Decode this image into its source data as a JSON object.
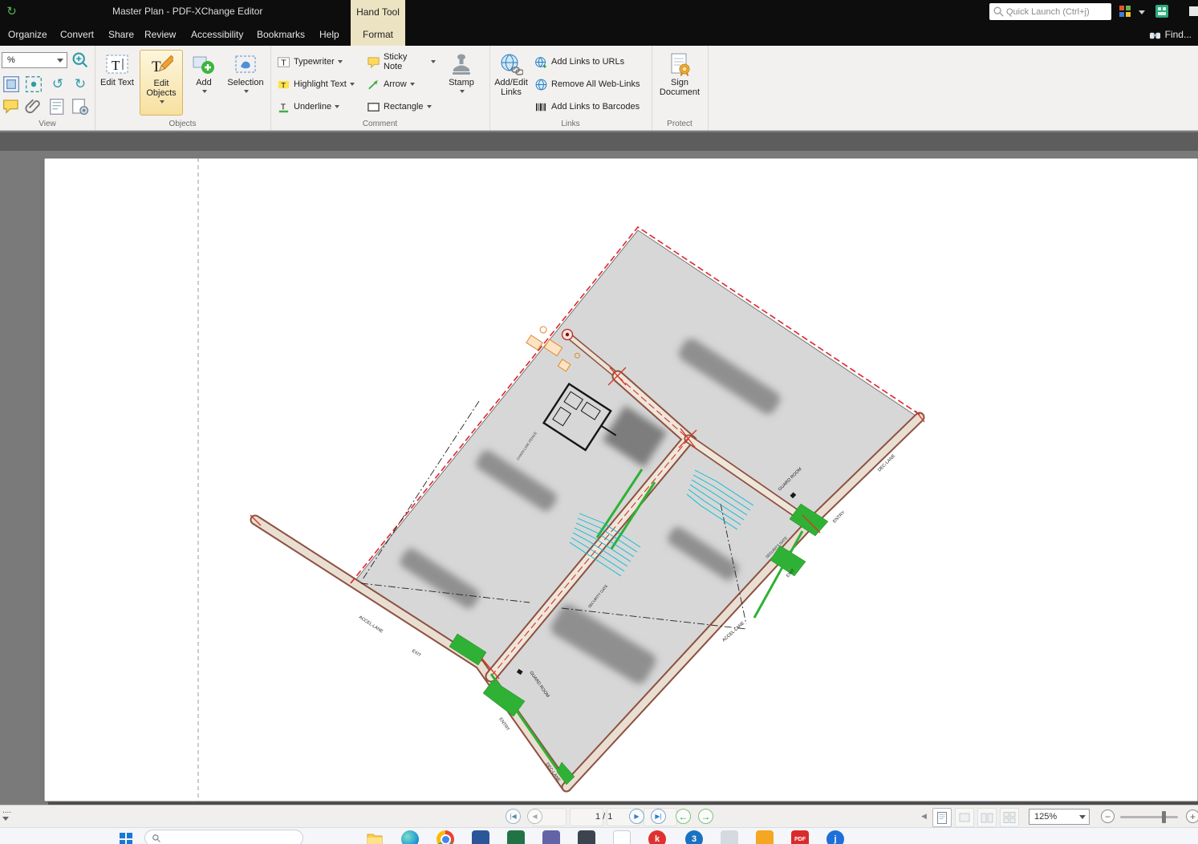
{
  "app": {
    "title": "Master Plan - PDF-XChange Editor",
    "tool_tab": "Hand Tool",
    "format_tab": "Format",
    "quick_launch_placeholder": "Quick Launch (Ctrl+j)",
    "find_label": "Find..."
  },
  "menu": {
    "items": [
      {
        "label": "Organize"
      },
      {
        "label": "Convert"
      },
      {
        "label": "Share"
      },
      {
        "label": "Review"
      },
      {
        "label": "Accessibility"
      },
      {
        "label": "Bookmarks"
      },
      {
        "label": "Help"
      }
    ]
  },
  "ribbon": {
    "view": {
      "group_label": "View",
      "zoom_value": "%"
    },
    "objects": {
      "group_label": "Objects",
      "edit_text": "Edit Text",
      "edit_objects": "Edit Objects",
      "add": "Add",
      "selection": "Selection"
    },
    "comment": {
      "group_label": "Comment",
      "typewriter": "Typewriter",
      "highlight": "Highlight Text",
      "underline": "Underline",
      "sticky_note": "Sticky Note",
      "arrow": "Arrow",
      "rectangle": "Rectangle",
      "stamp": "Stamp"
    },
    "links": {
      "group_label": "Links",
      "add_edit": "Add/Edit Links",
      "to_urls": "Add Links to URLs",
      "remove_web": "Remove All Web-Links",
      "to_barcodes": "Add Links to Barcodes"
    },
    "protect": {
      "group_label": "Protect",
      "sign": "Sign Document"
    }
  },
  "statusbar": {
    "overflow": "....",
    "page_indicator": "1 / 1",
    "zoom_value": "125%"
  },
  "plan": {
    "labels": {
      "accel_left": "ACCEL-LANE",
      "exit_left": "EXIT",
      "entry_left": "ENTRY",
      "dec_left": "DEC-LANE",
      "guard_left": "GUARD ROOM",
      "dec_right": "DEC-LANE",
      "entry_right": "ENTRY",
      "exit_right": "EXIT",
      "accel_right": "ACCEL-LANE",
      "guard_right": "GUARD ROOM",
      "security_right": "SECURITY GATE",
      "security_center": "SECURITY GATE",
      "chain_link": "CHAIN LINK FENCE"
    }
  },
  "taskbar": {
    "pdf_badge": "PDF",
    "k_badge": "k",
    "count_badge": "3",
    "j_badge": "j"
  }
}
